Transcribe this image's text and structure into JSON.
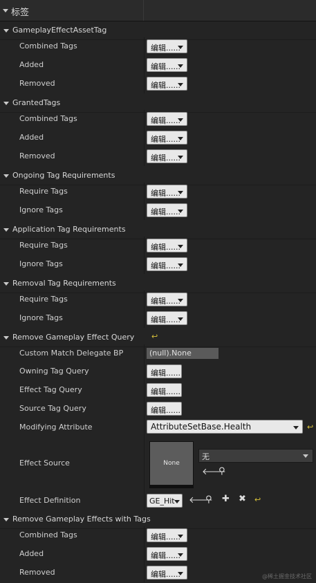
{
  "header": {
    "title": "标签"
  },
  "edit_label": "编辑......",
  "g1": {
    "title": "GameplayEffectAssetTag",
    "combined": "Combined Tags",
    "added": "Added",
    "removed": "Removed"
  },
  "g2": {
    "title": "GrantedTags",
    "combined": "Combined Tags",
    "added": "Added",
    "removed": "Removed"
  },
  "g3": {
    "title": "Ongoing Tag Requirements",
    "require": "Require Tags",
    "ignore": "Ignore Tags"
  },
  "g4": {
    "title": "Application Tag Requirements",
    "require": "Require Tags",
    "ignore": "Ignore Tags"
  },
  "g5": {
    "title": "Removal Tag Requirements",
    "require": "Require Tags",
    "ignore": "Ignore Tags"
  },
  "g6": {
    "title": "Remove Gameplay Effect Query",
    "custom_label": "Custom Match Delegate BP",
    "custom_value": "(null).None",
    "owning": "Owning Tag Query",
    "effect_tag": "Effect Tag Query",
    "source_tag": "Source Tag Query",
    "modifying": "Modifying Attribute",
    "modifying_value": "AttributeSetBase.Health",
    "effect_source": "Effect Source",
    "thumb_text": "None",
    "source_combo": "无",
    "effect_def": "Effect Definition",
    "effect_def_value": "GE_Hit"
  },
  "g7": {
    "title": "Remove Gameplay Effects with Tags",
    "combined": "Combined Tags",
    "added": "Added",
    "removed": "Removed"
  },
  "watermark": "@稀土掘金技术社区"
}
